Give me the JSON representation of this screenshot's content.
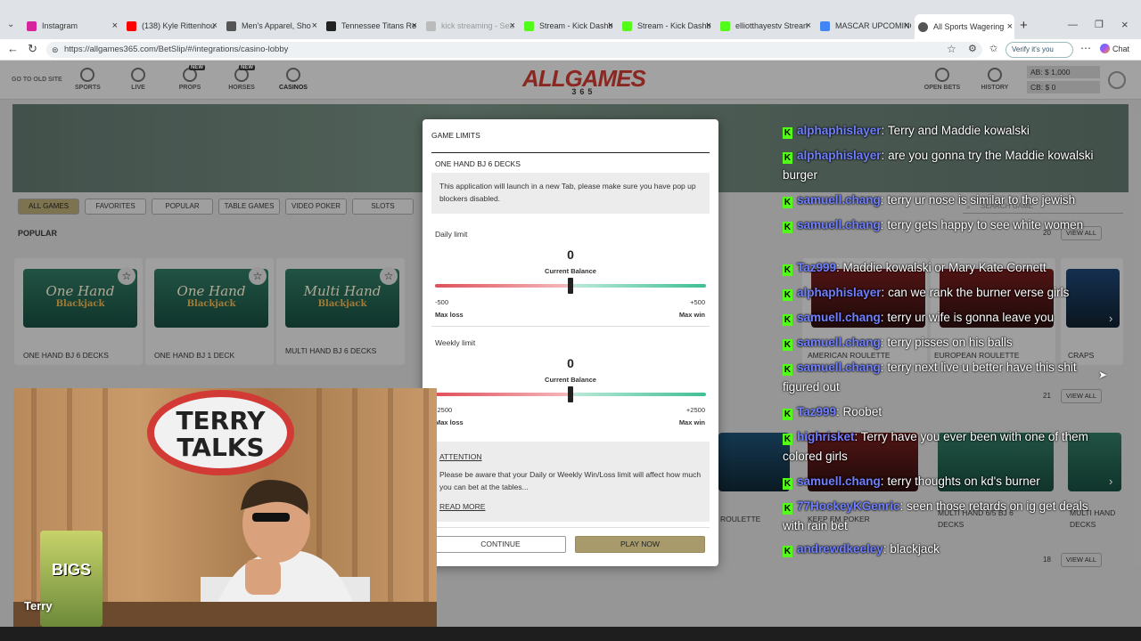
{
  "browser": {
    "tabs": [
      {
        "label": "Instagram",
        "color": "#d6249f"
      },
      {
        "label": "(138) Kyle Rittenhou",
        "color": "#ff0000"
      },
      {
        "label": "Men's Apparel, Sho",
        "color": "#555555"
      },
      {
        "label": "Tennessee Titans Re",
        "color": "#222222"
      },
      {
        "label": "kick streaming - Sea",
        "color": "#999999"
      },
      {
        "label": "Stream - Kick Dashb",
        "color": "#53fc18"
      },
      {
        "label": "Stream - Kick Dashb",
        "color": "#53fc18"
      },
      {
        "label": "elliotthayestv Strean",
        "color": "#53fc18"
      },
      {
        "label": "MASCAR UPCOMING",
        "color": "#4285f4"
      },
      {
        "label": "All Sports Wagering",
        "color": "#555555"
      }
    ],
    "url": "https://allgames365.com/BetSlip/#/integrations/casino-lobby",
    "verify_label": "Verify it's you",
    "chat_label": "Chat"
  },
  "site": {
    "go_old": "GO TO OLD SITE",
    "nav": [
      "SPORTS",
      "LIVE",
      "PROPS",
      "HORSES",
      "CASINOS"
    ],
    "new_badge": "NEW",
    "logo": "ALLGAMES",
    "logo_sub": "365",
    "open_bets": "OPEN BETS",
    "history": "HISTORY",
    "ab": "AB: $ 1,000",
    "cb": "CB: $ 0",
    "filters": [
      "ALL GAMES",
      "FAVORITES",
      "POPULAR",
      "TABLE GAMES",
      "VIDEO POKER",
      "SLOTS"
    ],
    "search_placeholder": "SEARCH GAME",
    "popular_title": "POPULAR",
    "popular_count": "20",
    "count2": "21",
    "count3": "18",
    "view_all": "VIEW ALL",
    "cards": [
      {
        "t1": "One Hand",
        "t2": "Blackjack",
        "label": "ONE HAND BJ 6 DECKS"
      },
      {
        "t1": "One Hand",
        "t2": "Blackjack",
        "label": "ONE HAND BJ 1 DECK"
      },
      {
        "t1": "Multi Hand",
        "t2": "Blackjack",
        "label": "MULTI HAND BJ 6 DECKS"
      }
    ],
    "right_cards": [
      "AMERICAN ROULETTE",
      "EUROPEAN ROULETTE",
      "CRAPS"
    ],
    "row2_labels": [
      "ROULETTE",
      "KEEP EM POKER",
      "MULTI HAND 6/5 BJ 6 DECKS",
      "MULTI HAND DECKS"
    ]
  },
  "modal": {
    "title": "GAME LIMITS",
    "game": "ONE HAND BJ 6 DECKS",
    "notice": "This application will launch in a new Tab, please make sure you have pop up blockers disabled.",
    "daily_label": "Daily limit",
    "daily_value": "0",
    "current_balance": "Current Balance",
    "daily_min": "-500",
    "daily_max": "+500",
    "daily_level": 0.5,
    "max_loss": "Max loss",
    "max_win": "Max win",
    "weekly_label": "Weekly limit",
    "weekly_value": "0",
    "weekly_min": "-2500",
    "weekly_max": "+2500",
    "weekly_level": 0.5,
    "attention": "ATTENTION",
    "attention_text": "Please be aware that your Daily or Weekly Win/Loss limit will affect how much you can bet at the tables...",
    "read_more": "READ MORE",
    "continue": "CONTINUE",
    "play_now": "PLAY NOW"
  },
  "stream": {
    "sign": "TERRY TALKS",
    "name": "Terry",
    "bag": "BIGS"
  },
  "chat": [
    {
      "user": "alphaphislayer",
      "text": "Terry and Maddie kowalski"
    },
    {
      "user": "alphaphislayer",
      "text": "are you gonna try the Maddie kowalski burger"
    },
    {
      "user": "samuell.chang",
      "text": "terry ur nose is similar to the jewish"
    },
    {
      "user": "samuell.chang",
      "text": "terry gets happy to see white women"
    },
    {
      "user": "Taz999",
      "text": "Maddie kowalski or Mary Kate Cornett"
    },
    {
      "user": "alphaphislayer",
      "text": "can we rank the burner verse girls"
    },
    {
      "user": "samuell.chang",
      "text": "terry ur wife is gonna leave you"
    },
    {
      "user": "samuell.chang",
      "text": "terry pisses on his balls"
    },
    {
      "user": "samuell.chang",
      "text": "terry next live u better have this shit figured out"
    },
    {
      "user": "Taz999",
      "text": "Roobet"
    },
    {
      "user": "highrisket",
      "text": "Terry have you ever been with one of them colored girls"
    },
    {
      "user": "samuell.chang",
      "text": "terry thoughts on kd's burner"
    },
    {
      "user": "77HockeyKGenric",
      "text": "seen those retards on ig get deals with rain bet"
    },
    {
      "user": "andrewdkeeley",
      "text": "blackjack"
    }
  ]
}
